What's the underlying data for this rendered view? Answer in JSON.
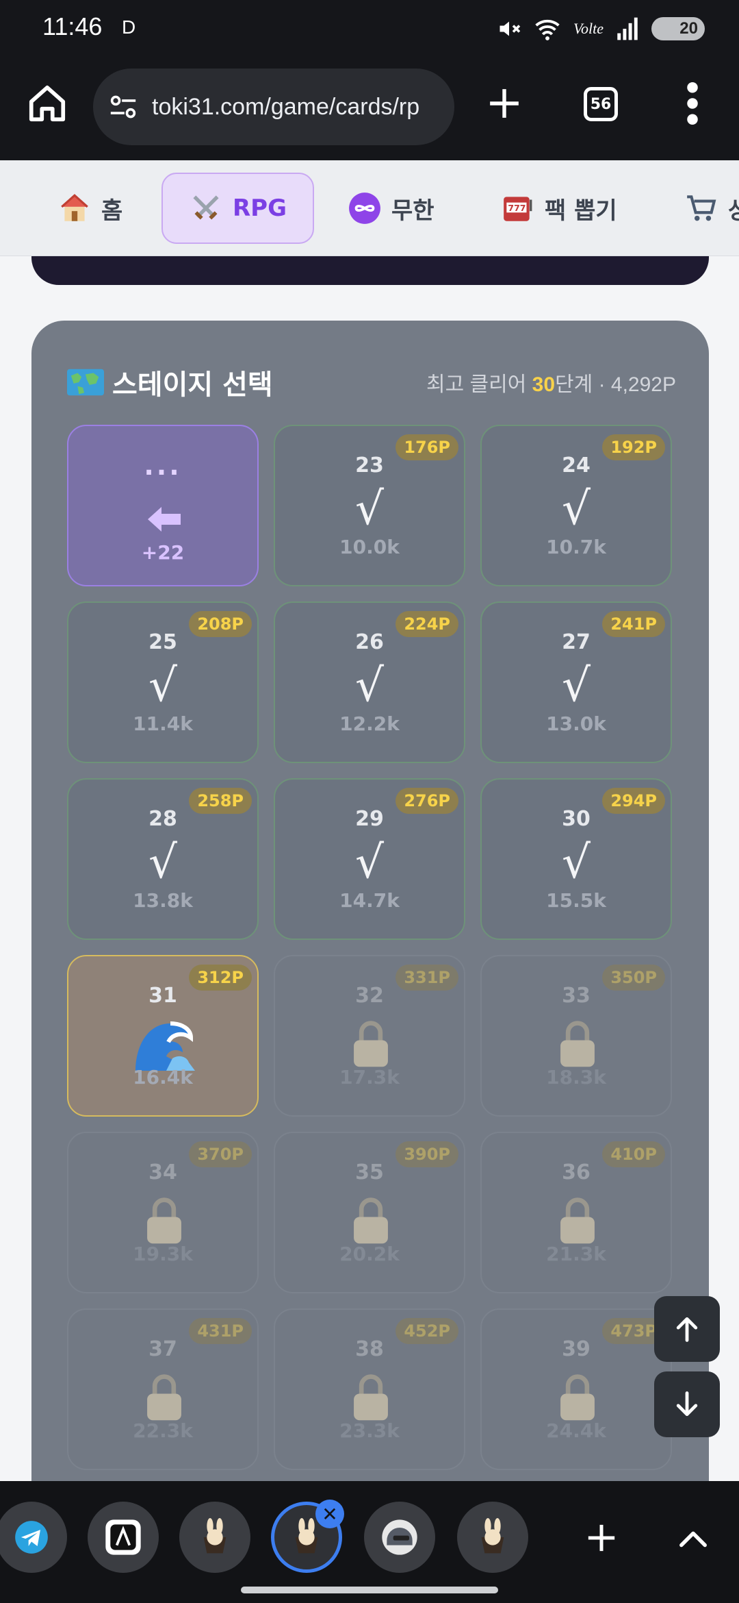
{
  "status_bar": {
    "time": "11:46",
    "indicator": "D",
    "volte": "Volte",
    "battery": "20"
  },
  "browser": {
    "url": "toki31.com/game/cards/rp",
    "tab_count": "56"
  },
  "site_nav": {
    "items": [
      {
        "label": "홈",
        "icon": "house-icon"
      },
      {
        "label": "RPG",
        "icon": "crossed-swords-icon",
        "active": true
      },
      {
        "label": "무한",
        "icon": "infinity-icon"
      },
      {
        "label": "팩 뽑기",
        "icon": "slot-machine-icon"
      },
      {
        "label": "상",
        "icon": "cart-icon"
      }
    ]
  },
  "stage_panel": {
    "title": "스테이지 선택",
    "best_clear_label": "최고 클리어",
    "best_clear_value": "30",
    "best_clear_unit": "단계 · 4,292P",
    "previous": {
      "dots": "...",
      "count": "+22"
    },
    "stages": [
      {
        "num": "23",
        "reward": "176P",
        "score": "10.0k",
        "status": "cleared"
      },
      {
        "num": "24",
        "reward": "192P",
        "score": "10.7k",
        "status": "cleared"
      },
      {
        "num": "25",
        "reward": "208P",
        "score": "11.4k",
        "status": "cleared"
      },
      {
        "num": "26",
        "reward": "224P",
        "score": "12.2k",
        "status": "cleared"
      },
      {
        "num": "27",
        "reward": "241P",
        "score": "13.0k",
        "status": "cleared"
      },
      {
        "num": "28",
        "reward": "258P",
        "score": "13.8k",
        "status": "cleared"
      },
      {
        "num": "29",
        "reward": "276P",
        "score": "14.7k",
        "status": "cleared"
      },
      {
        "num": "30",
        "reward": "294P",
        "score": "15.5k",
        "status": "cleared"
      },
      {
        "num": "31",
        "reward": "312P",
        "score": "16.4k",
        "status": "current"
      },
      {
        "num": "32",
        "reward": "331P",
        "score": "17.3k",
        "status": "locked"
      },
      {
        "num": "33",
        "reward": "350P",
        "score": "18.3k",
        "status": "locked"
      },
      {
        "num": "34",
        "reward": "370P",
        "score": "19.3k",
        "status": "locked"
      },
      {
        "num": "35",
        "reward": "390P",
        "score": "20.2k",
        "status": "locked"
      },
      {
        "num": "36",
        "reward": "410P",
        "score": "21.3k",
        "status": "locked"
      },
      {
        "num": "37",
        "reward": "431P",
        "score": "22.3k",
        "status": "locked"
      },
      {
        "num": "38",
        "reward": "452P",
        "score": "23.3k",
        "status": "locked"
      },
      {
        "num": "39",
        "reward": "473P",
        "score": "24.4k",
        "status": "locked"
      }
    ],
    "check_mark": "√"
  },
  "tab_strip": {
    "close_glyph": "✕",
    "tabs": [
      {
        "icon": "telegram-icon"
      },
      {
        "icon": "app-icon"
      },
      {
        "icon": "rabbit-icon"
      },
      {
        "icon": "rabbit-icon",
        "active": true
      },
      {
        "icon": "helmet-icon"
      },
      {
        "icon": "rabbit-icon"
      }
    ]
  },
  "colors": {
    "accent_purple": "#7b3fe4",
    "reward_gold": "#f7d34a",
    "tab_active_blue": "#3d7ef0"
  }
}
